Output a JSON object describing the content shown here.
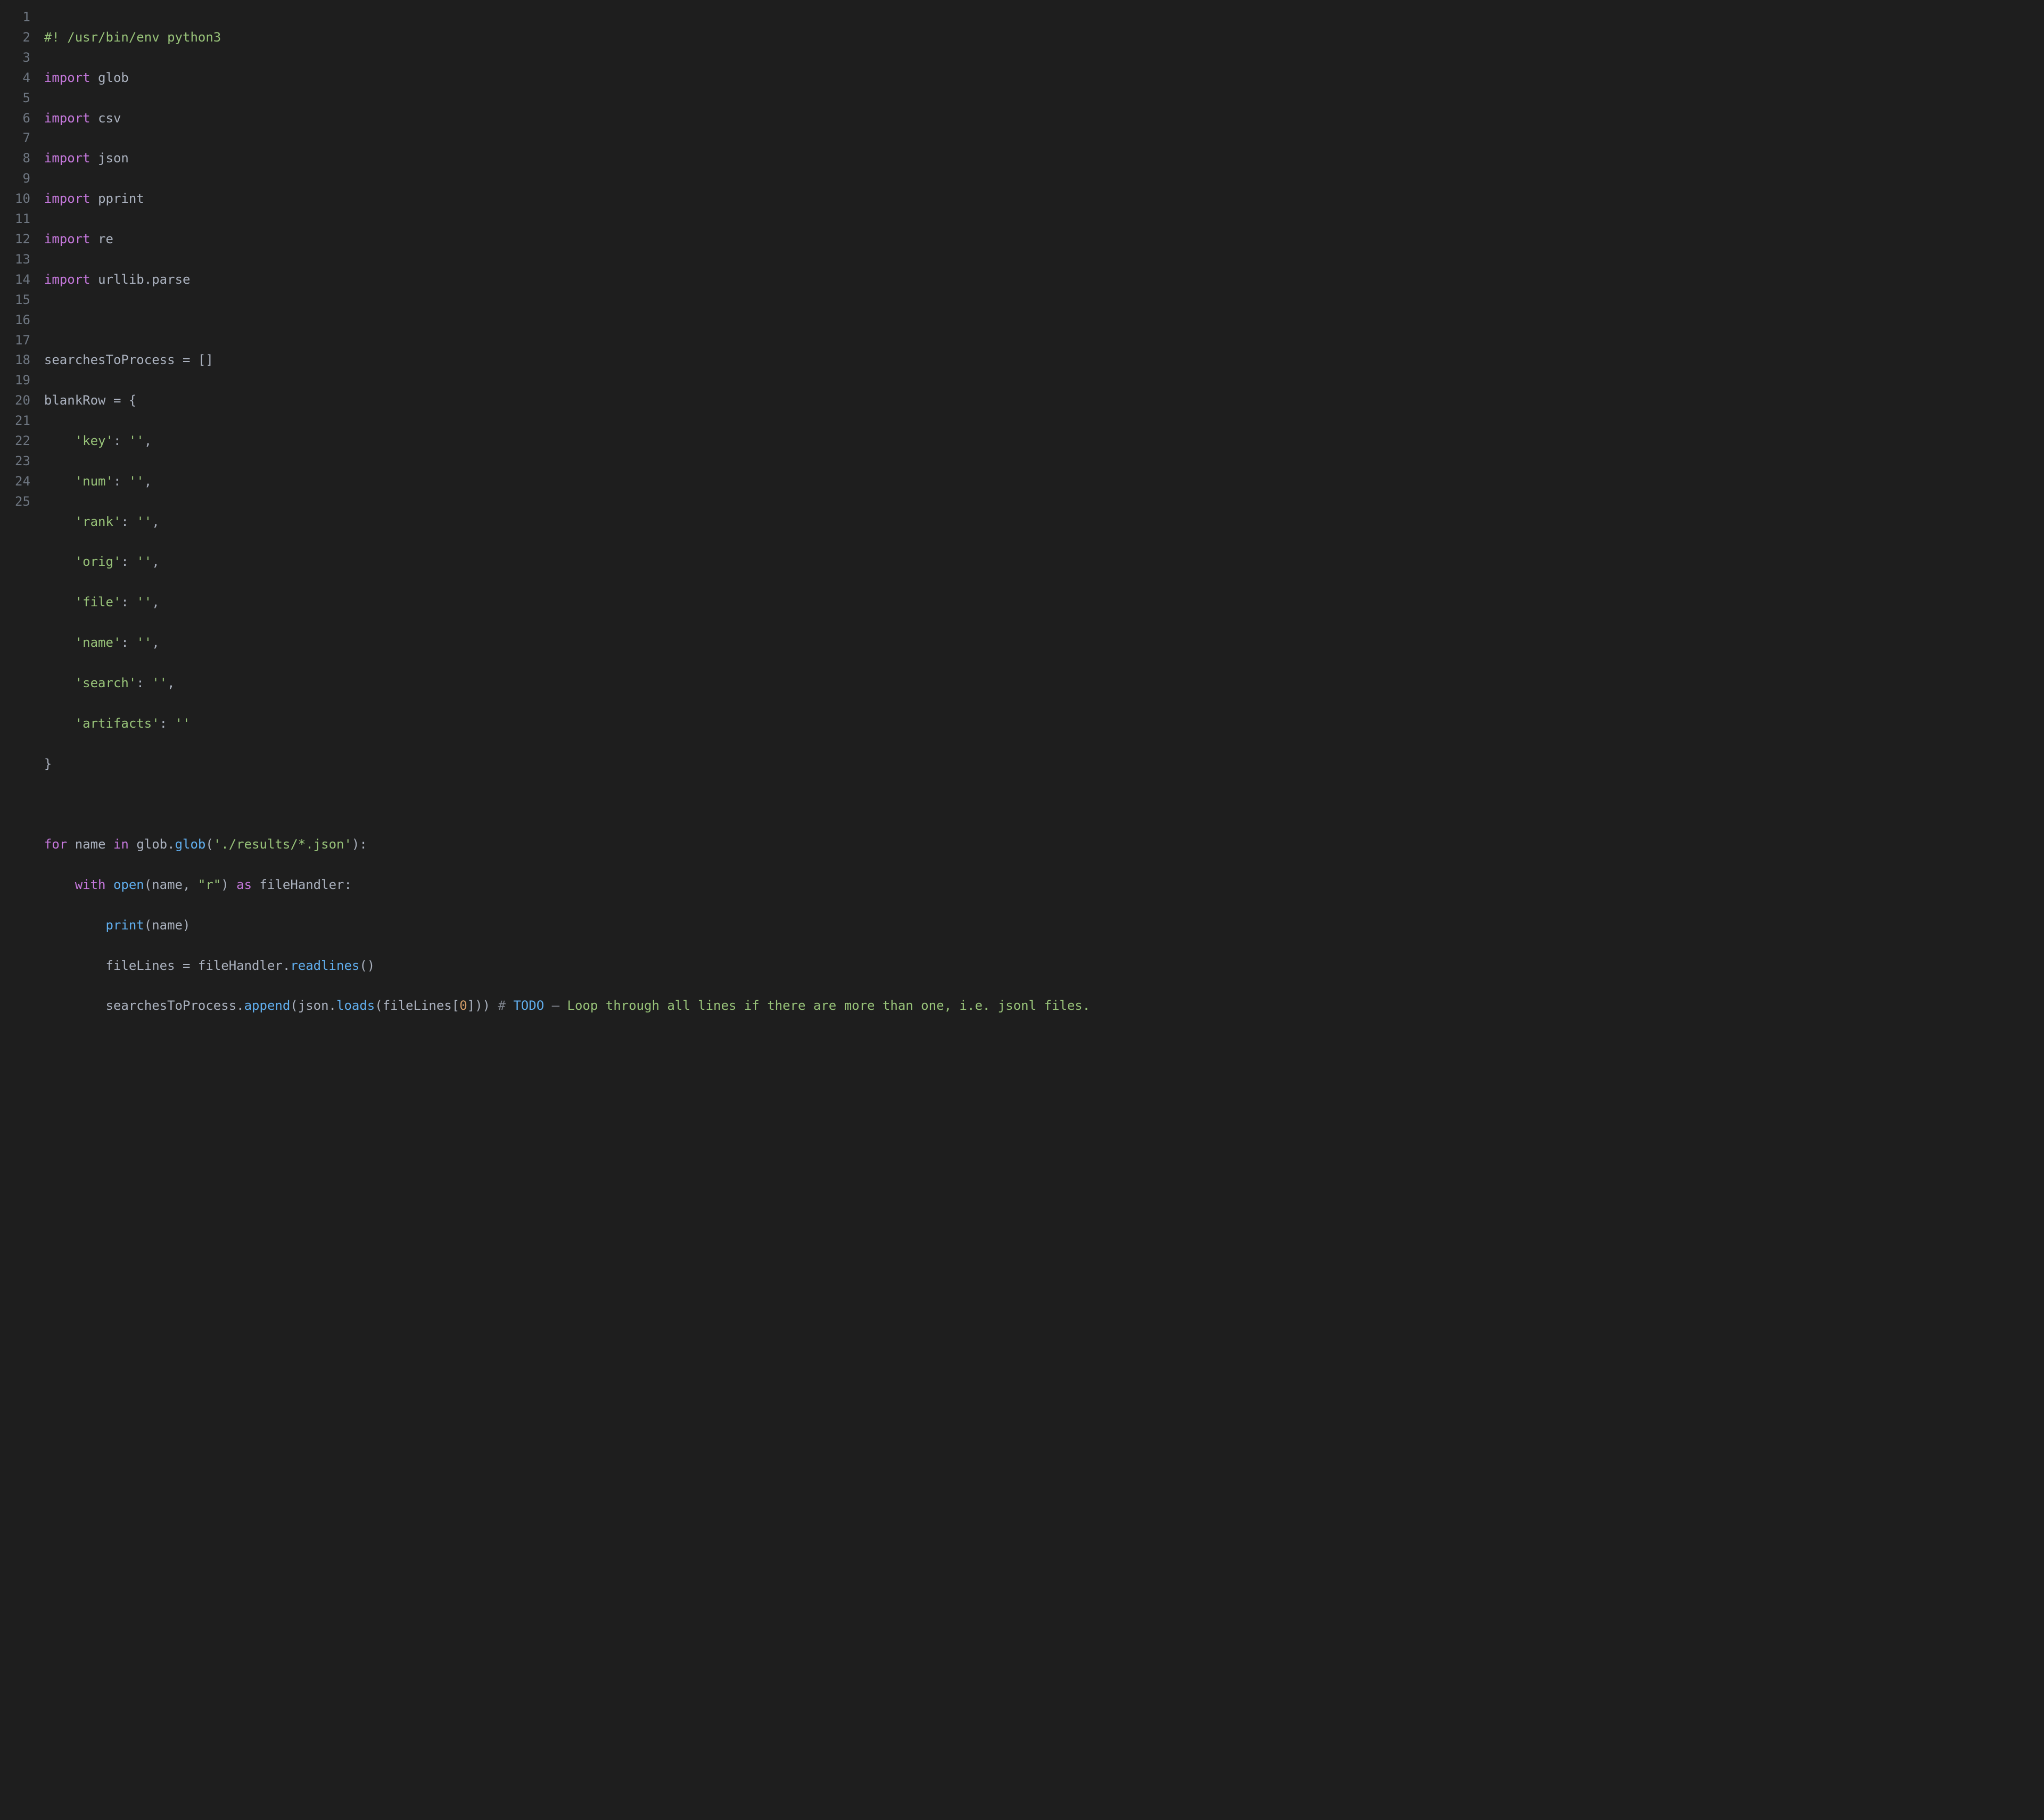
{
  "lines": {
    "count": 25,
    "l1": {
      "comment": "#! /usr/bin/env python3"
    },
    "l2": {
      "kw": "import",
      "mod": "glob"
    },
    "l3": {
      "kw": "import",
      "mod": "csv"
    },
    "l4": {
      "kw": "import",
      "mod": "json"
    },
    "l5": {
      "kw": "import",
      "mod": "pprint"
    },
    "l6": {
      "kw": "import",
      "mod": "re"
    },
    "l7": {
      "kw": "import",
      "mod": "urllib",
      "sub": "parse"
    },
    "l9": {
      "var": "searchesToProcess",
      "eq": " = []"
    },
    "l10": {
      "var": "blankRow",
      "eq": " = {"
    },
    "l11": {
      "key": "'key'",
      "colon": ": ",
      "val": "''",
      "comma": ","
    },
    "l12": {
      "key": "'num'",
      "colon": ": ",
      "val": "''",
      "comma": ","
    },
    "l13": {
      "key": "'rank'",
      "colon": ": ",
      "val": "''",
      "comma": ","
    },
    "l14": {
      "key": "'orig'",
      "colon": ": ",
      "val": "''",
      "comma": ","
    },
    "l15": {
      "key": "'file'",
      "colon": ": ",
      "val": "''",
      "comma": ","
    },
    "l16": {
      "key": "'name'",
      "colon": ": ",
      "val": "''",
      "comma": ","
    },
    "l17": {
      "key": "'search'",
      "colon": ": ",
      "val": "''",
      "comma": ","
    },
    "l18": {
      "key": "'artifacts'",
      "colon": ": ",
      "val": "''"
    },
    "l19": {
      "close": "}"
    },
    "l21": {
      "kw_for": "for",
      "it": "name",
      "kw_in": "in",
      "mod": "glob",
      "meth": "glob",
      "arg": "'./results/*.json'",
      "end": "):"
    },
    "l22": {
      "kw_with": "with",
      "fn_open": "open",
      "arg1": "name",
      "arg2": "\"r\"",
      "kw_as": "as",
      "alias": "fileHandler",
      "end": ":"
    },
    "l23": {
      "fn": "print",
      "arg": "name"
    },
    "l24": {
      "lhs": "fileLines",
      "eq": " = ",
      "obj": "fileHandler",
      "meth": "readlines",
      "paren": "()"
    },
    "l25": {
      "obj": "searchesToProcess",
      "meth": "append",
      "inner_obj": "json",
      "inner_meth": "loads",
      "inner_arg": "fileLines",
      "idx": "0",
      "hash": "#",
      "todo": "TODO",
      "dash": "–",
      "tail": "Loop through all lines if there are more than one, i.e. jsonl files."
    }
  },
  "gutter": [
    "1",
    "2",
    "3",
    "4",
    "5",
    "6",
    "7",
    "8",
    "9",
    "10",
    "11",
    "12",
    "13",
    "14",
    "15",
    "16",
    "17",
    "18",
    "19",
    "20",
    "21",
    "22",
    "23",
    "24",
    "25"
  ]
}
